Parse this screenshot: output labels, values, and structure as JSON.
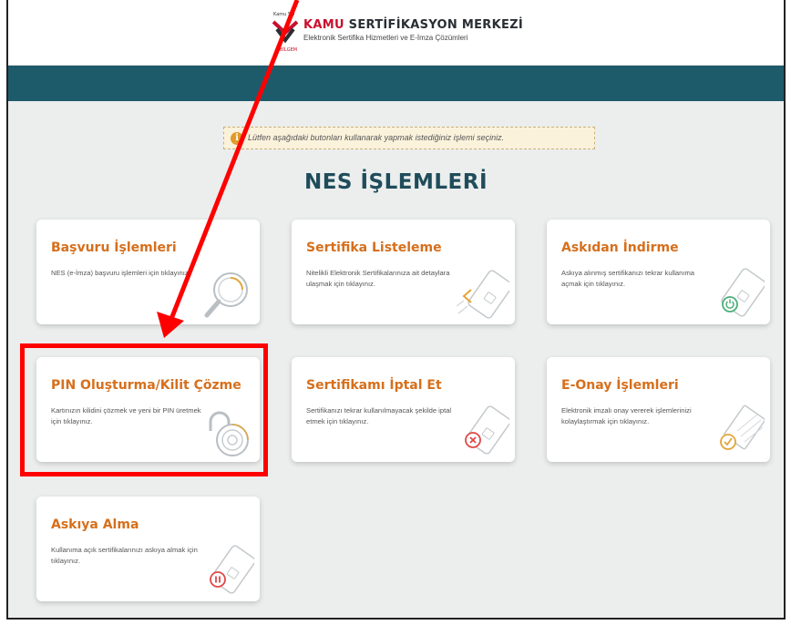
{
  "header": {
    "logo_small_text": "Kamu SM",
    "logo_side_text": "BİLGEM",
    "brand_kamu": "KAMU",
    "brand_rest": "SERTİFİKASYON MERKEZİ",
    "subtitle": "Elektronik Sertifika Hizmetleri ve E-İmza Çözümleri"
  },
  "info": {
    "icon": "info-icon",
    "text": "Lütfen aşağıdaki butonları kullanarak yapmak istediğiniz işlemi seçiniz."
  },
  "page_title": "NES İŞLEMLERİ",
  "cards": [
    {
      "title": "Başvuru İşlemleri",
      "desc": "NES (e-İmza) başvuru işlemleri için tıklayınız.",
      "icon": "magnifier-icon"
    },
    {
      "title": "Sertifika Listeleme",
      "desc": "Nitelikli Elektronik Sertifikalarınıza ait detaylara ulaşmak için tıklayınız.",
      "icon": "card-list-icon"
    },
    {
      "title": "Askıdan İndirme",
      "desc": "Askıya alınmış sertifikanızı tekrar kullanıma açmak için tıklayınız.",
      "icon": "card-power-icon"
    },
    {
      "title": "PIN Oluşturma/Kilit Çözme",
      "desc": "Kartınızın kilidini çözmek ve yeni bir PIN üretmek için tıklayınız.",
      "icon": "padlock-icon"
    },
    {
      "title": "Sertifikamı İptal Et",
      "desc": "Sertifikanızı tekrar kullanılmayacak şekilde iptal etmek için tıklayınız.",
      "icon": "card-cancel-icon"
    },
    {
      "title": "E-Onay İşlemleri",
      "desc": "Elektronik imzalı onay vererek işlemlerinizi kolaylaştırmak için tıklayınız.",
      "icon": "document-check-icon"
    },
    {
      "title": "Askıya Alma",
      "desc": "Kullanıma açık sertifikalarınızı askıya almak için tıklayınız.",
      "icon": "card-pause-icon"
    }
  ],
  "colors": {
    "teal_bar": "#1d5b6b",
    "heading": "#1f4c5a",
    "card_title": "#d66f1c",
    "brand_red": "#c8102e",
    "annotation": "#ff0000"
  },
  "annotation": {
    "highlight_target": "PIN Oluşturma/Kilit Çözme"
  }
}
